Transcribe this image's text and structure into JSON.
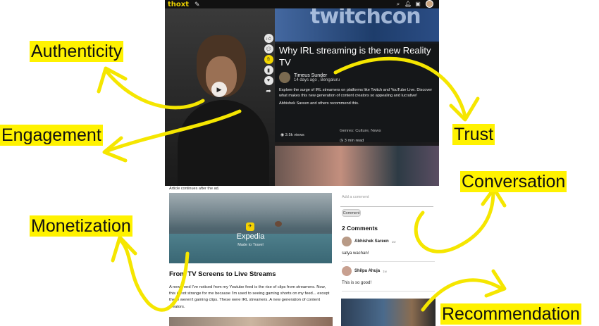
{
  "app": {
    "logo": "thoxt",
    "icons": [
      "edit-icon",
      "search-icon",
      "bell-icon",
      "message-icon",
      "user-avatar"
    ]
  },
  "video": {
    "rail_icons": [
      "like-icon",
      "comment-icon",
      "appreciate-icon",
      "bookmark-icon",
      "heart-icon",
      "share-icon"
    ]
  },
  "article": {
    "banner_text": "twitchcon",
    "title": "Why IRL streaming is the new Reality TV",
    "author": "Timeus Sunder",
    "meta": "14 days ago , Bengaluru",
    "description": "Explore the surge of IRL streamers on platforms like Twitch and YouTube Live. Discover what makes this new generation of content creators so appealing and lucrative!",
    "recommend": "Abhishek Sareen and others recommend this.",
    "views": "3.5k views",
    "genres": "Genres: Culture, News",
    "read_time": "3 min read"
  },
  "ad": {
    "note": "Article continues after the ad.",
    "brand": "Expedia",
    "tagline": "Made to Travel"
  },
  "body": {
    "heading": "From TV Screens to Live Streams",
    "paragraph": "A new trend I've noticed from my Youtube feed is the rise of clips from streamers. Now, this is not strange for me because I'm used to seeing gaming shorts on my feed... except these weren't gaming clips. These were IRL streamers. A new generation of content creators."
  },
  "comments": {
    "placeholder": "Add a comment",
    "button": "Comment",
    "heading": "2 Comments",
    "items": [
      {
        "name": "Abhishek Sareen",
        "time": "1w",
        "text": "satya wachan!"
      },
      {
        "name": "Shilpa Ahuja",
        "time": "1w",
        "text": "This is so good!"
      }
    ]
  },
  "annotations": {
    "authenticity": "Authenticity",
    "engagement": "Engagement",
    "monetization": "Monetization",
    "trust": "Trust",
    "conversation": "Conversation",
    "recommendation": "Recommendation"
  },
  "colors": {
    "highlight": "#fff200",
    "brand_accent": "#f2d600",
    "overlay": "#141414"
  }
}
